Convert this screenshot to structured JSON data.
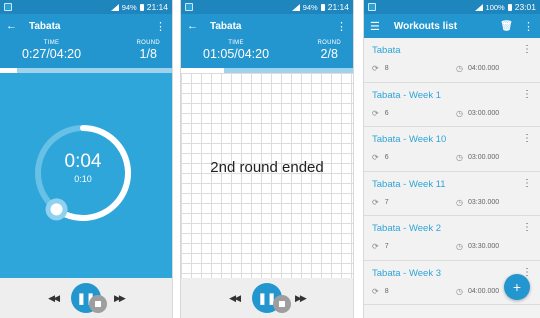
{
  "screen1": {
    "status": {
      "battery": "94%",
      "time": "21:14"
    },
    "toolbar": {
      "title": "Tabata"
    },
    "info": {
      "time_label": "TIME",
      "time_value": "0:27/04:20",
      "round_label": "ROUND",
      "round_value": "1/8"
    },
    "progress_fraction": 0.1,
    "timer": {
      "main": "0:04",
      "sub": "0:10",
      "ring_fraction": 0.6
    }
  },
  "screen2": {
    "status": {
      "battery": "94%",
      "time": "21:14"
    },
    "toolbar": {
      "title": "Tabata"
    },
    "info": {
      "time_label": "TIME",
      "time_value": "01:05/04:20",
      "round_label": "ROUND",
      "round_value": "2/8"
    },
    "progress_fraction": 0.25,
    "message": "2nd round ended"
  },
  "screen3": {
    "status": {
      "battery": "100%",
      "time": "23:01"
    },
    "toolbar": {
      "title": "Workouts list"
    },
    "workouts": [
      {
        "name": "Tabata",
        "reps": "8",
        "duration": "04:00.000"
      },
      {
        "name": "Tabata - Week  1",
        "reps": "6",
        "duration": "03:00.000"
      },
      {
        "name": "Tabata - Week 10",
        "reps": "6",
        "duration": "03:00.000"
      },
      {
        "name": "Tabata - Week 11",
        "reps": "7",
        "duration": "03:30.000"
      },
      {
        "name": "Tabata - Week 2",
        "reps": "7",
        "duration": "03:30.000"
      },
      {
        "name": "Tabata - Week 3",
        "reps": "8",
        "duration": "04:00.000"
      }
    ]
  },
  "colors": {
    "primary": "#2496cf",
    "primary_dark": "#1e86bd",
    "accent_text": "#2fa4d8",
    "timer_bg": "#2ea6da"
  }
}
